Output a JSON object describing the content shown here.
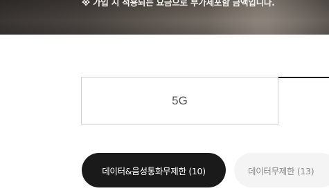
{
  "banner": {
    "notice": "※ 가입 시 적용되는 요금으로 부가세포함 금액입니다."
  },
  "plan_tabs": [
    {
      "label": "5G"
    }
  ],
  "filter_chips": [
    {
      "label": "데이터&음성통화무제한 (10)",
      "selected": true
    },
    {
      "label": "데이터무제한 (13)",
      "selected": false
    }
  ]
}
